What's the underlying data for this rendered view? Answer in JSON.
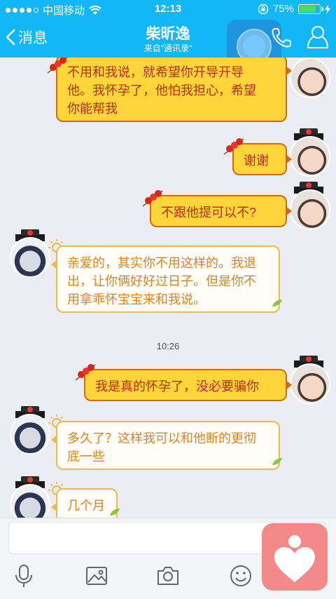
{
  "status_bar": {
    "carrier": "中国移动",
    "time": "12:13",
    "battery_percent": "75%",
    "battery_level": 0.75
  },
  "nav": {
    "back_label": "消息",
    "contact_name": "柴昕逸",
    "subtitle": "来自\"通讯录\""
  },
  "messages": [
    {
      "direction": "outgoing",
      "text_lines": [
        "不用和我说，就希望你开导开导",
        "他。我怀孕了，他怕我担心，希望",
        "你能帮我"
      ]
    },
    {
      "direction": "outgoing",
      "text_lines": [
        "谢谢"
      ]
    },
    {
      "direction": "outgoing",
      "text_lines": [
        "不跟他提可以不?"
      ]
    },
    {
      "direction": "incoming",
      "text_lines": [
        "亲爱的，其实你不用这样的。我退",
        "出，让你俩好好过日子。但是你不",
        "用拿乖怀宝宝来和我说。"
      ]
    },
    {
      "direction": "outgoing",
      "text_lines": [
        "我是真的怀孕了，没必要骗你"
      ]
    },
    {
      "direction": "incoming",
      "text_lines": [
        "多久了？这样我可以和他断的更彻",
        "底一些"
      ]
    },
    {
      "direction": "incoming",
      "text_lines": [
        "几个月"
      ]
    }
  ],
  "timestamp": "10:26",
  "input": {
    "placeholder": ""
  },
  "icons": [
    "mic-icon",
    "image-icon",
    "camera-icon",
    "emoji-icon",
    "heart-app-icon",
    "phone-icon",
    "profile-icon"
  ],
  "colors": {
    "accent": "#12b7f5",
    "outgoing_bubble": "#ffd53b",
    "outgoing_text": "#c02a0c",
    "incoming_text": "#e0821c"
  }
}
